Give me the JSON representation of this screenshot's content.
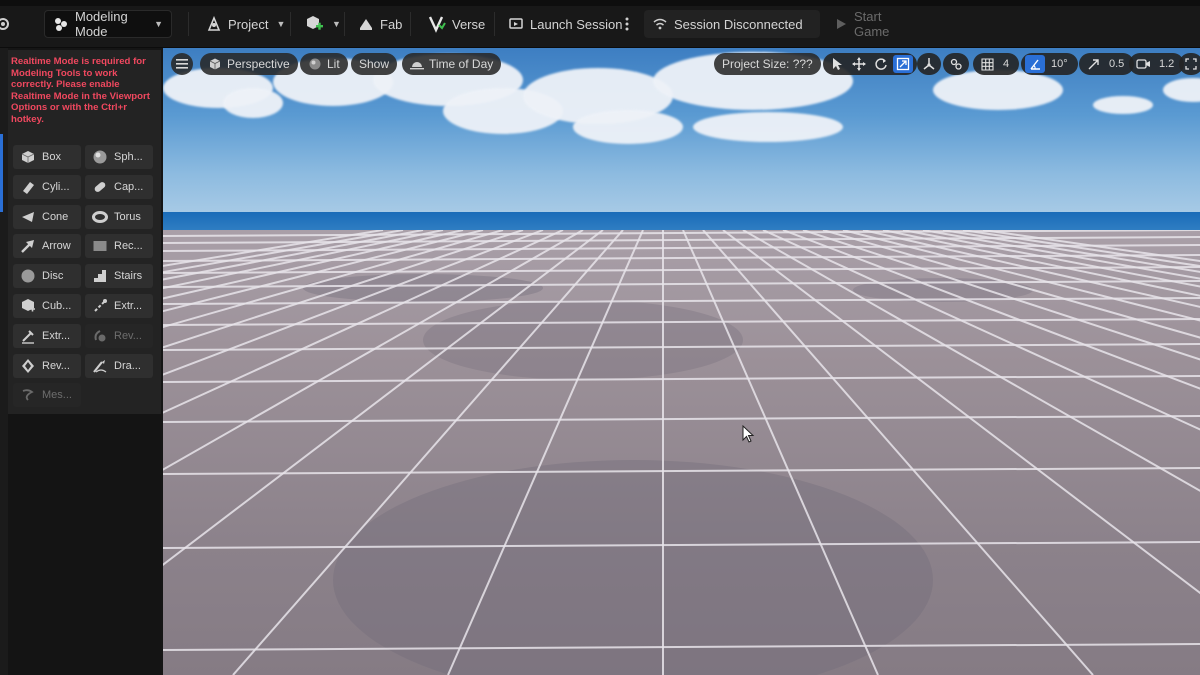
{
  "toolbar": {
    "mode_label": "Modeling Mode",
    "project_label": "Project",
    "fab_label": "Fab",
    "verse_label": "Verse",
    "launch_label": "Launch Session",
    "session_status": "Session Disconnected",
    "start_label": "Start Game"
  },
  "modeling_panel": {
    "warning": "Realtime Mode is required for Modeling Tools to work correctly. Please enable Realtime Mode in the Viewport Options or with the Ctrl+r hotkey.",
    "tools": [
      {
        "label": "Box",
        "icon": "box-icon"
      },
      {
        "label": "Sph...",
        "icon": "sphere-icon"
      },
      {
        "label": "Cyli...",
        "icon": "cylinder-icon"
      },
      {
        "label": "Cap...",
        "icon": "capsule-icon"
      },
      {
        "label": "Cone",
        "icon": "cone-icon"
      },
      {
        "label": "Torus",
        "icon": "torus-icon"
      },
      {
        "label": "Arrow",
        "icon": "arrow-icon"
      },
      {
        "label": "Rec...",
        "icon": "rectangle-icon"
      },
      {
        "label": "Disc",
        "icon": "disc-icon"
      },
      {
        "label": "Stairs",
        "icon": "stairs-icon"
      },
      {
        "label": "Cub...",
        "icon": "cubegrid-icon"
      },
      {
        "label": "Extr...",
        "icon": "extrude-path-icon"
      },
      {
        "label": "Extr...",
        "icon": "extrude-polygon-icon"
      },
      {
        "label": "Rev...",
        "icon": "revolve-path-icon"
      },
      {
        "label": "Rev...",
        "icon": "revolve-boundary-icon"
      },
      {
        "label": "Dra...",
        "icon": "draw-spline-icon"
      },
      {
        "label": "Mes...",
        "icon": "mesh-spline-icon"
      }
    ]
  },
  "viewport": {
    "perspective_label": "Perspective",
    "lit_label": "Lit",
    "show_label": "Show",
    "time_of_day_label": "Time of Day",
    "project_size_label": "Project Size: ???",
    "grid_value": "4",
    "angle_value": "10°",
    "scale_value": "0.5",
    "camera_speed_value": "1.2"
  },
  "colors": {
    "accent": "#2a6fd6",
    "warning": "#f0485f",
    "panel_bg": "#232323"
  }
}
